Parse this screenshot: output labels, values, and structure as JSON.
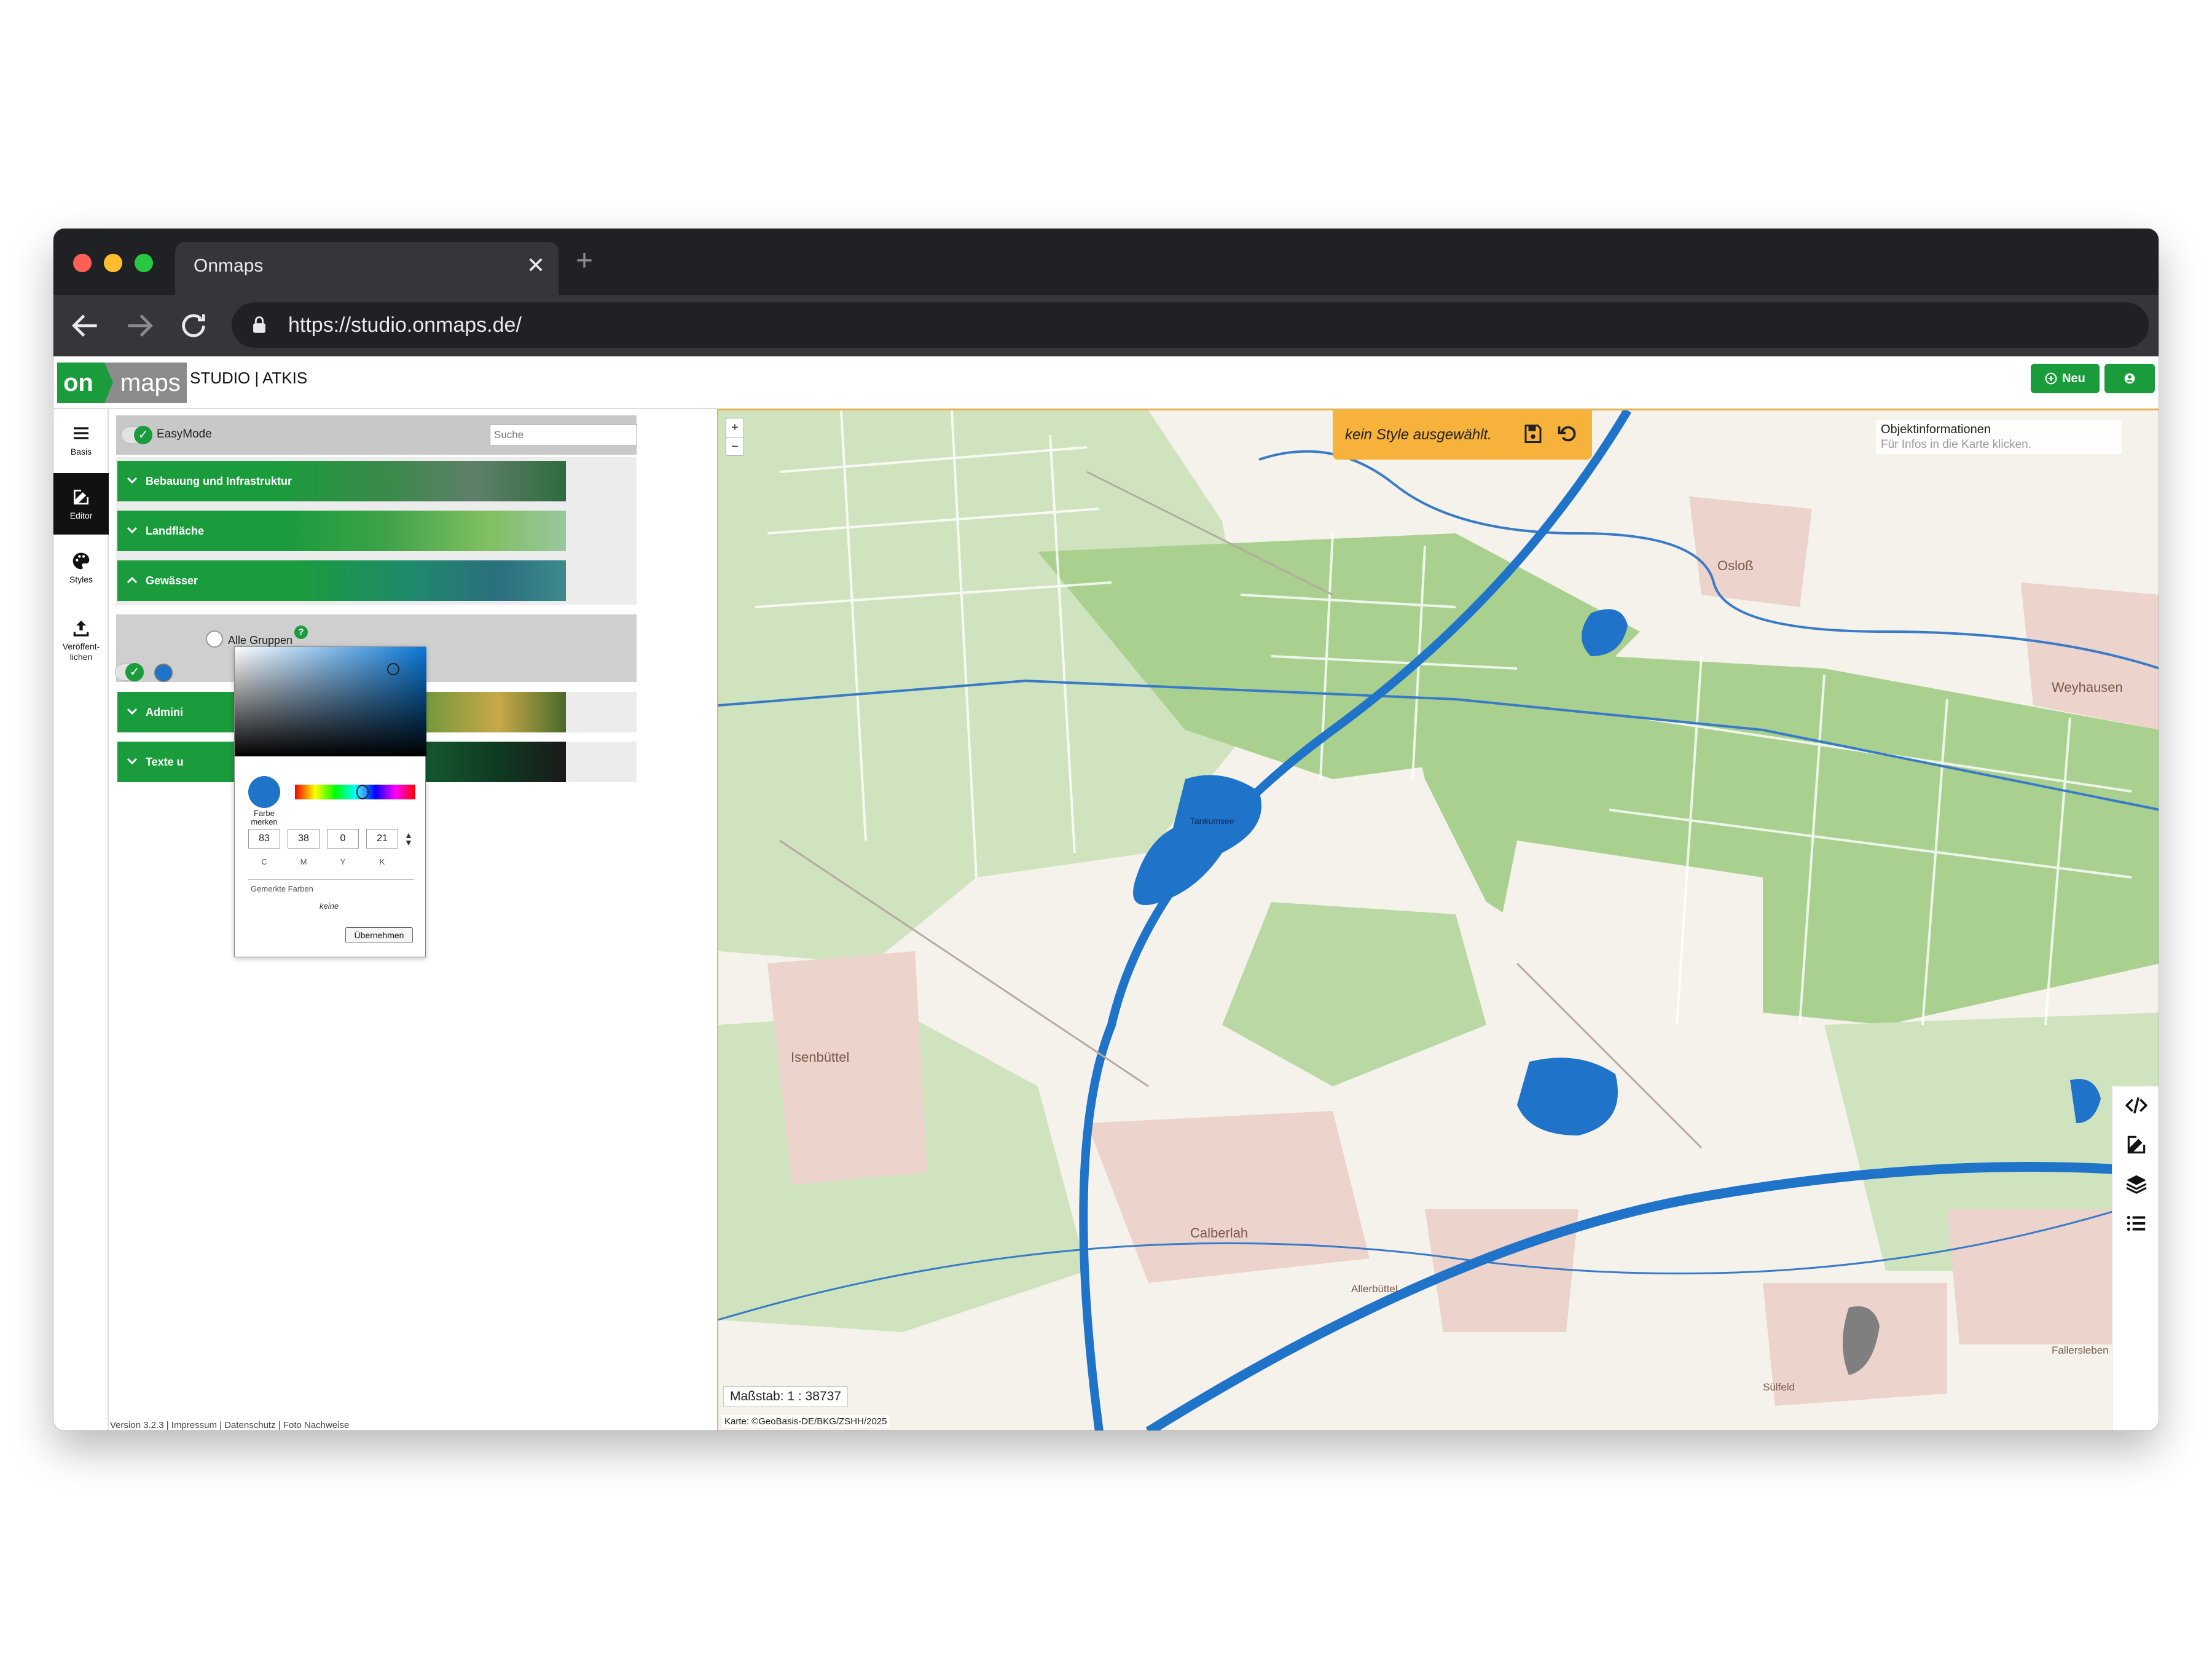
{
  "browser": {
    "tab_title": "Onmaps",
    "tab_close": "✕",
    "new_tab": "+",
    "url": "https://studio.onmaps.de/"
  },
  "header": {
    "logo_on": "on",
    "logo_maps": "maps",
    "title": "STUDIO | ATKIS",
    "new_label": "Neu"
  },
  "rail": {
    "basis": "Basis",
    "editor": "Editor",
    "styles": "Styles",
    "publish_1": "Veröffent-",
    "publish_2": "lichen"
  },
  "panel": {
    "easymode_label": "EasyMode",
    "search_placeholder": "Suche",
    "categories": [
      {
        "label": "Bebauung und Infrastruktur"
      },
      {
        "label": "Landfläche"
      },
      {
        "label": "Gewässer"
      },
      {
        "label": "Admini"
      },
      {
        "label": "Texte u"
      }
    ],
    "all_groups": "Alle Gruppen",
    "help": "?"
  },
  "picker": {
    "remember_label_1": "Farbe",
    "remember_label_2": "merken",
    "c": "83",
    "m": "38",
    "y": "0",
    "k": "21",
    "c_label": "C",
    "m_label": "M",
    "y_label": "Y",
    "k_label": "K",
    "saved_label": "Gemerkte Farben",
    "saved_none": "keine",
    "apply": "Übernehmen",
    "swatch_color": "#1f73c8"
  },
  "footer": "Version 3.2.3 | Impressum | Datenschutz | Foto Nachweise",
  "map": {
    "zoom_in": "+",
    "zoom_out": "−",
    "style_status": "kein Style ausgewählt.",
    "objinfo_title": "Objektinformationen",
    "objinfo_sub": "Für Infos in die Karte klicken.",
    "scale": "Maßstab: 1 : 38737",
    "credit": "Karte: ©GeoBasis-DE/BKG/ZSHH/2025",
    "places": {
      "osloss": "Osloß",
      "weyhausen": "Weyhausen",
      "isenbuttel": "Isenbüttel",
      "calberlah": "Calberlah",
      "allerbuttel": "Allerbüttel",
      "sulfeld": "Sülfeld",
      "fallersleben": "Fallersleben",
      "lake": "Tankumsee"
    }
  },
  "colors": {
    "accent_green": "#1a9c3c",
    "style_bar": "#f6b23a",
    "water": "#1f73c8"
  }
}
